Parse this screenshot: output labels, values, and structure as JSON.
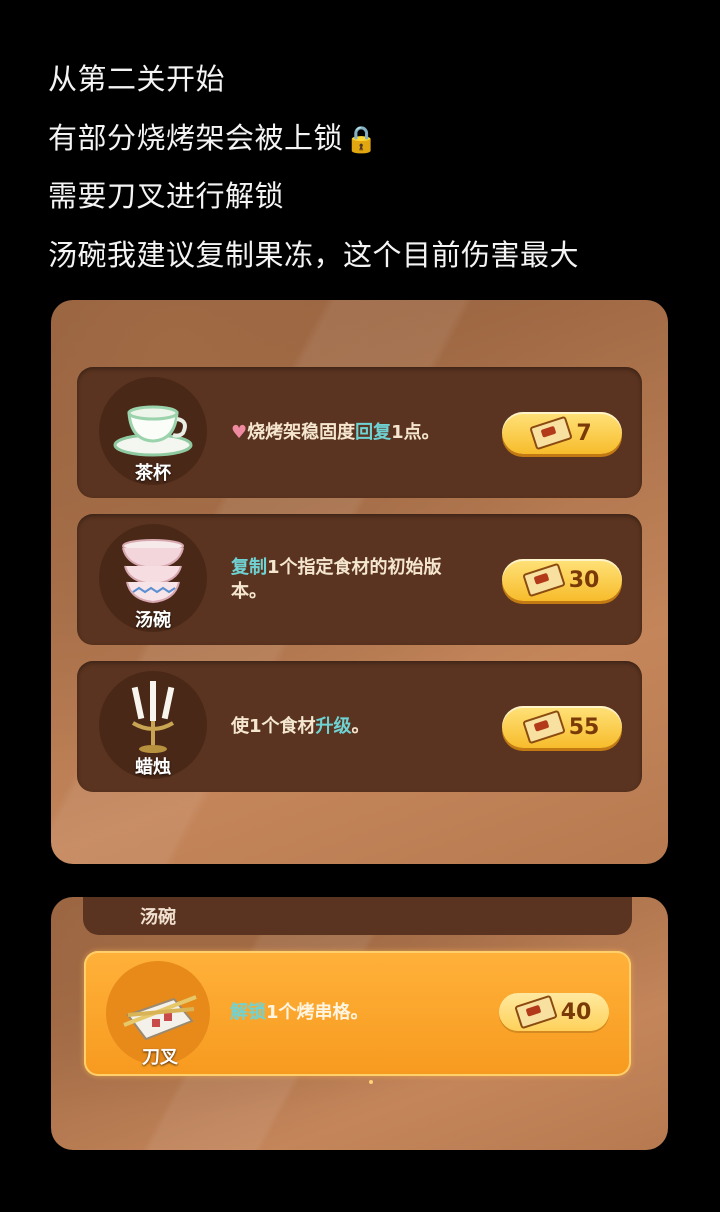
{
  "intro": {
    "lines": [
      "从第二关开始",
      "有部分烧烤架会被上锁",
      "需要刀叉进行解锁",
      "汤碗我建议复制果冻，这个目前伤害最大"
    ],
    "lock_emoji": "🔒"
  },
  "items": [
    {
      "name": "茶杯",
      "icon": "teacup-icon",
      "desc_parts": [
        "♥",
        "烧烤架稳固度",
        "回复",
        "1点。"
      ],
      "price": "7"
    },
    {
      "name": "汤碗",
      "icon": "bowl-icon",
      "desc_parts": [
        "复制",
        "1个指定食材的初始版本。"
      ],
      "price": "30"
    },
    {
      "name": "蜡烛",
      "icon": "candelabra-icon",
      "desc_parts": [
        "使1个食材",
        "升级",
        "。"
      ],
      "price": "55"
    }
  ],
  "panel2": {
    "clipped_label": "汤碗",
    "selected": {
      "name": "刀叉",
      "icon": "knife-fork-icon",
      "desc_parts": [
        "解锁",
        "1个烤串格。"
      ],
      "price": "40"
    }
  },
  "colors": {
    "highlight": "#6fd3d4",
    "price_text": "#7a3a08",
    "selected_bg": "#f79a1f"
  }
}
